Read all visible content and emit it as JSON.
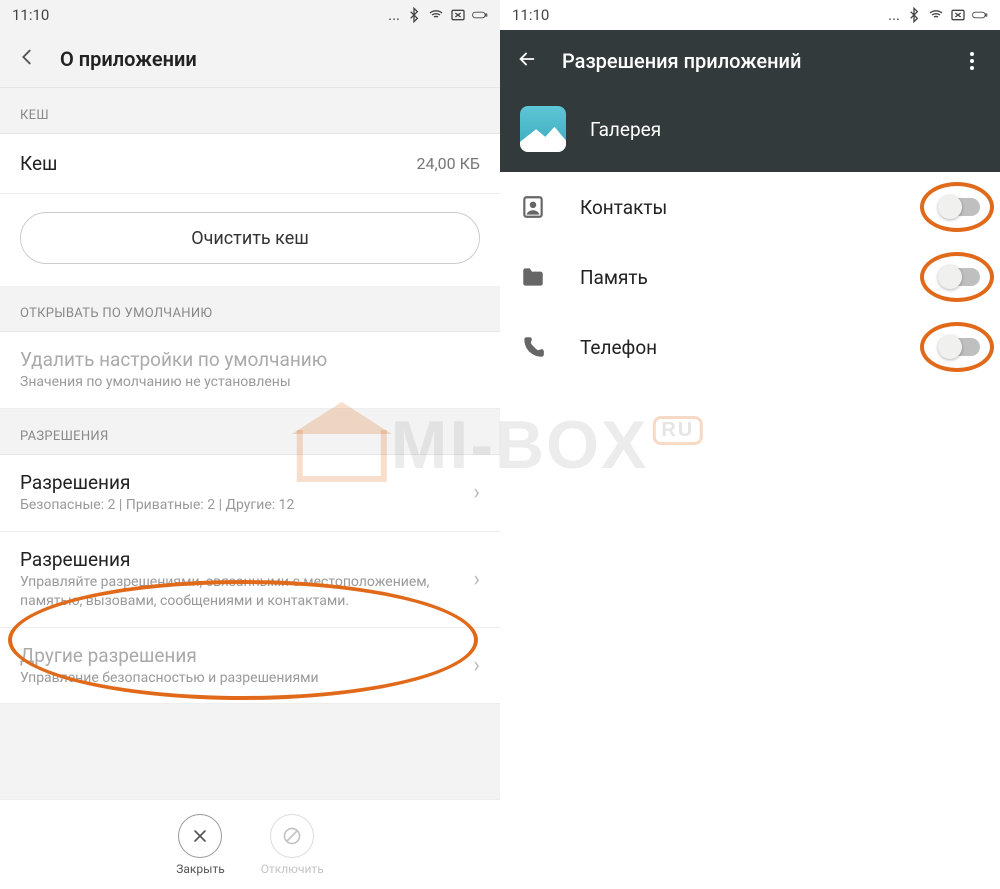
{
  "status": {
    "time": "11:10"
  },
  "left": {
    "header_title": "О приложении",
    "cache_section": "КЕШ",
    "cache_label": "Кеш",
    "cache_value": "24,00 КБ",
    "clear_cache": "Очистить кеш",
    "open_default_section": "ОТКРЫВАТЬ ПО УМОЛЧАНИЮ",
    "reset_defaults_title": "Удалить настройки по умолчанию",
    "reset_defaults_sub": "Значения по умолчанию не установлены",
    "permissions_section": "РАЗРЕШЕНИЯ",
    "perm1_title": "Разрешения",
    "perm1_sub": "Безопасные: 2 | Приватные: 2 | Другие: 12",
    "perm2_title": "Разрешения",
    "perm2_sub": "Управляйте разрешениями, связанными с местоположением, памятью, вызовами, сообщениями и контактами.",
    "perm3_title": "Другие разрешения",
    "perm3_sub": "Управление безопасностью и разрешениями",
    "close_label": "Закрыть",
    "disable_label": "Отключить"
  },
  "right": {
    "header_title": "Разрешения приложений",
    "app_name": "Галерея",
    "permissions": [
      {
        "icon": "contacts",
        "label": "Контакты",
        "enabled": false
      },
      {
        "icon": "storage",
        "label": "Память",
        "enabled": false
      },
      {
        "icon": "phone",
        "label": "Телефон",
        "enabled": false
      }
    ]
  },
  "watermark": {
    "text": "MI-BOX",
    "suffix": "RU"
  }
}
